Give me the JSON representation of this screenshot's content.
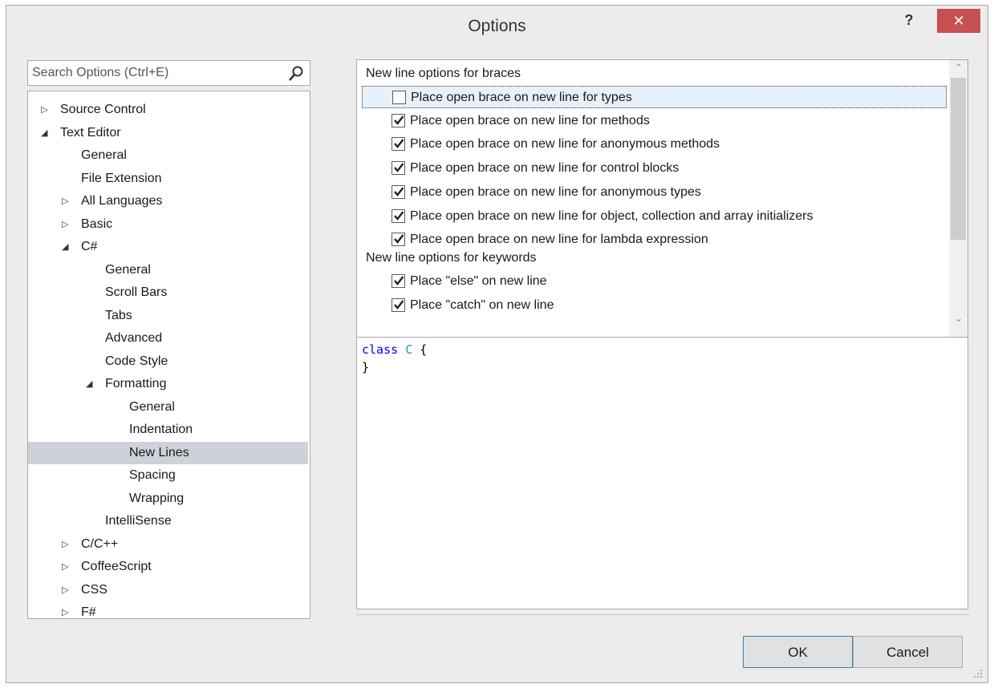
{
  "window": {
    "title": "Options",
    "help_label": "?",
    "close_label": "✕"
  },
  "search": {
    "placeholder": "Search Options (Ctrl+E)"
  },
  "tree": [
    {
      "label": "Source Control",
      "arrow": "▷",
      "indent": 0
    },
    {
      "label": "Text Editor",
      "arrow": "◢",
      "indent": 0
    },
    {
      "label": "General",
      "arrow": "",
      "indent": 1
    },
    {
      "label": "File Extension",
      "arrow": "",
      "indent": 1
    },
    {
      "label": "All Languages",
      "arrow": "▷",
      "indent": 1
    },
    {
      "label": "Basic",
      "arrow": "▷",
      "indent": 1
    },
    {
      "label": "C#",
      "arrow": "◢",
      "indent": 1
    },
    {
      "label": "General",
      "arrow": "",
      "indent": 2
    },
    {
      "label": "Scroll Bars",
      "arrow": "",
      "indent": 2
    },
    {
      "label": "Tabs",
      "arrow": "",
      "indent": 2
    },
    {
      "label": "Advanced",
      "arrow": "",
      "indent": 2
    },
    {
      "label": "Code Style",
      "arrow": "",
      "indent": 2
    },
    {
      "label": "Formatting",
      "arrow": "◢",
      "indent": 2
    },
    {
      "label": "General",
      "arrow": "",
      "indent": 3
    },
    {
      "label": "Indentation",
      "arrow": "",
      "indent": 3
    },
    {
      "label": "New Lines",
      "arrow": "",
      "indent": 3,
      "selected": true
    },
    {
      "label": "Spacing",
      "arrow": "",
      "indent": 3
    },
    {
      "label": "Wrapping",
      "arrow": "",
      "indent": 3
    },
    {
      "label": "IntelliSense",
      "arrow": "",
      "indent": 2
    },
    {
      "label": "C/C++",
      "arrow": "▷",
      "indent": 1
    },
    {
      "label": "CoffeeScript",
      "arrow": "▷",
      "indent": 1
    },
    {
      "label": "CSS",
      "arrow": "▷",
      "indent": 1
    },
    {
      "label": "F#",
      "arrow": "▷",
      "indent": 1
    }
  ],
  "options": {
    "braces_header": "New line options for braces",
    "braces": [
      {
        "label": "Place open brace on new line for types",
        "checked": false,
        "focused": true
      },
      {
        "label": "Place open brace on new line for methods",
        "checked": true
      },
      {
        "label": "Place open brace on new line for anonymous methods",
        "checked": true
      },
      {
        "label": "Place open brace on new line for control blocks",
        "checked": true
      },
      {
        "label": "Place open brace on new line for anonymous types",
        "checked": true
      },
      {
        "label": "Place open brace on new line for object, collection and array initializers",
        "checked": true
      },
      {
        "label": "Place open brace on new line for lambda expression",
        "checked": true
      }
    ],
    "keywords_header": "New line options for keywords",
    "keywords": [
      {
        "label": "Place \"else\" on new line",
        "checked": true
      },
      {
        "label": "Place \"catch\" on new line",
        "checked": true
      }
    ]
  },
  "preview": {
    "keyword": "class",
    "type_name": "C",
    "open_brace": "{",
    "close_brace": "}"
  },
  "buttons": {
    "ok": "OK",
    "cancel": "Cancel"
  }
}
